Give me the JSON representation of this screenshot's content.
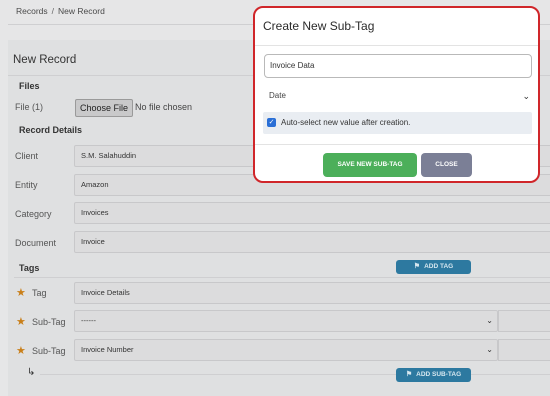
{
  "breadcrumb": {
    "root": "Records",
    "separator": "/",
    "current": "New Record"
  },
  "form": {
    "title": "New Record",
    "files": {
      "heading": "Files",
      "file_label": "File (1)",
      "choose_label": "Choose File",
      "no_file": "No file chosen"
    },
    "details": {
      "heading": "Record Details",
      "client": {
        "label": "Client",
        "value": "S.M. Salahuddin"
      },
      "entity": {
        "label": "Entity",
        "value": "Amazon"
      },
      "category": {
        "label": "Category",
        "value": "Invoices"
      },
      "document": {
        "label": "Document",
        "value": "Invoice"
      }
    },
    "tags": {
      "heading": "Tags",
      "add_tag_label": "ADD TAG",
      "tag": {
        "label": "Tag",
        "value": "Invoice Details"
      },
      "subtag1": {
        "label": "Sub-Tag",
        "value": "------"
      },
      "subtag2": {
        "label": "Sub-Tag",
        "value": "Invoice Number"
      },
      "add_subtag_label": "ADD SUB-TAG"
    }
  },
  "modal": {
    "title": "Create New Sub-Tag",
    "input_value": "Invoice Data",
    "type_value": "Date",
    "auto_select_label": "Auto-select new value after creation.",
    "auto_select_checked": true,
    "save_label": "SAVE NEW SUB-TAG",
    "close_label": "CLOSE",
    "colors": {
      "border": "#d0262a",
      "save": "#4caf5a",
      "close": "#7b7f96",
      "pill": "#2d79a0",
      "star": "#c97f19"
    }
  }
}
